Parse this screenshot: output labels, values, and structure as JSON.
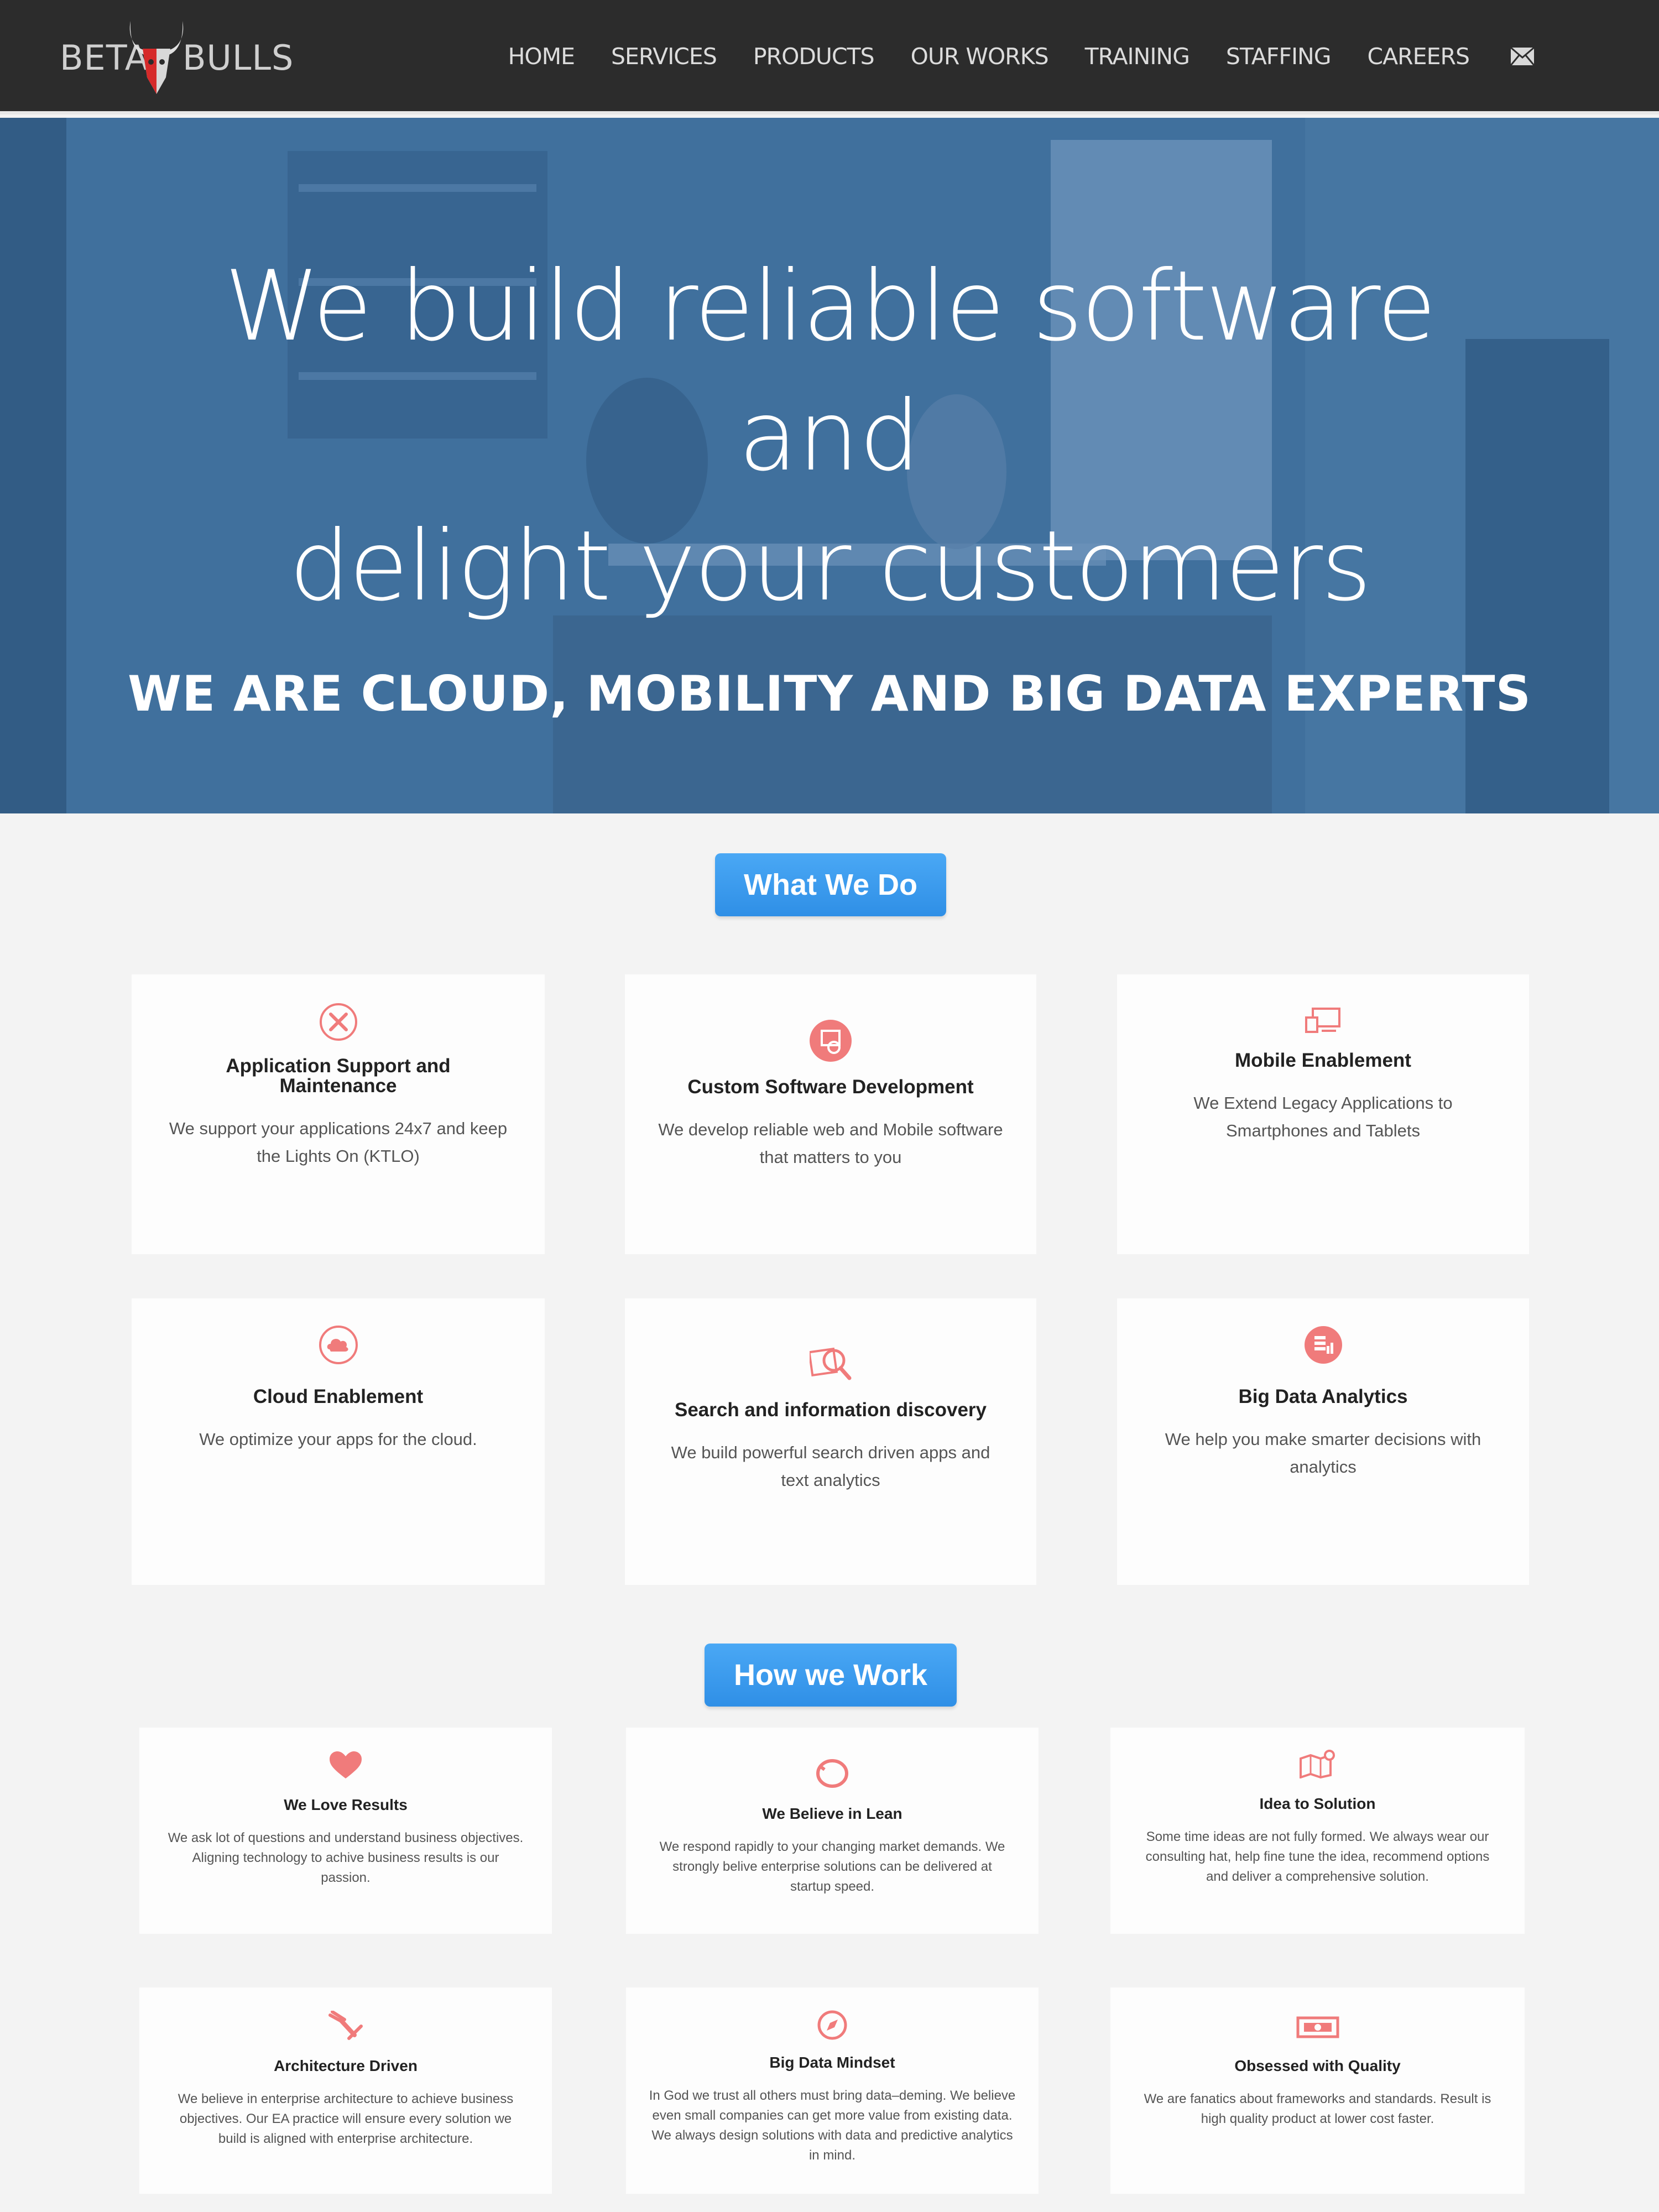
{
  "brand": {
    "left": "BETA",
    "right": "BULLS"
  },
  "nav": [
    {
      "label": "HOME"
    },
    {
      "label": "SERVICES"
    },
    {
      "label": "PRODUCTS"
    },
    {
      "label": "OUR WORKS"
    },
    {
      "label": "TRAINING"
    },
    {
      "label": "STAFFING"
    },
    {
      "label": "CAREERS"
    }
  ],
  "hero": {
    "line1": "We build reliable software",
    "line2": "and",
    "line3": "delight your customers",
    "subtitle": "WE ARE CLOUD, MOBILITY AND BIG DATA EXPERTS"
  },
  "what_we_do": {
    "title": "What We Do",
    "cards": [
      {
        "icon": "tools-icon",
        "title": "Application Support and Maintenance",
        "text": "We support your applications 24x7 and keep the Lights On (KTLO)"
      },
      {
        "icon": "code-icon",
        "title": "Custom Software Development",
        "text": "We develop reliable web and Mobile software that matters to you"
      },
      {
        "icon": "devices-icon",
        "title": "Mobile Enablement",
        "text": "We Extend Legacy Applications to Smartphones and Tablets"
      },
      {
        "icon": "cloud-icon",
        "title": "Cloud Enablement",
        "text": "We optimize your apps for the cloud."
      },
      {
        "icon": "search-icon",
        "title": "Search and information discovery",
        "text": "We build powerful search driven apps and text analytics"
      },
      {
        "icon": "analytics-icon",
        "title": "Big Data Analytics",
        "text": "We help you make smarter decisions with analytics"
      }
    ]
  },
  "how_we_work": {
    "title": "How we Work",
    "cards": [
      {
        "icon": "heart-icon",
        "title": "We Love Results",
        "text": "We ask lot of questions and understand business objectives. Aligning technology to achive business results is our passion."
      },
      {
        "icon": "lifebuoy-icon",
        "title": "We Believe in Lean",
        "text": "We respond rapidly to your changing market demands. We strongly belive enterprise solutions can be delivered at startup speed."
      },
      {
        "icon": "map-icon",
        "title": "Idea to Solution",
        "text": "Some time ideas are not fully formed. We always wear our consulting hat, help fine tune the idea, recommend options and deliver a comprehensive solution."
      },
      {
        "icon": "architecture-icon",
        "title": "Architecture Driven",
        "text": "We believe in enterprise architecture to achieve business objectives. Our EA practice will ensure every solution we build is aligned with enterprise architecture."
      },
      {
        "icon": "compass-icon",
        "title": "Big Data Mindset",
        "text": "In God we trust all others must bring data–deming. We believe even small companies can get more value from existing data. We always design solutions with data and predictive analytics in mind."
      },
      {
        "icon": "money-icon",
        "title": "Obsessed with Quality",
        "text": "We are fanatics about frameworks and standards. Result is high quality product at lower cost faster."
      }
    ]
  },
  "colors": {
    "accent": "#f07b7b",
    "button": "#3a9bef",
    "header": "#2c2c2c",
    "hero": "#3f6d9a"
  }
}
